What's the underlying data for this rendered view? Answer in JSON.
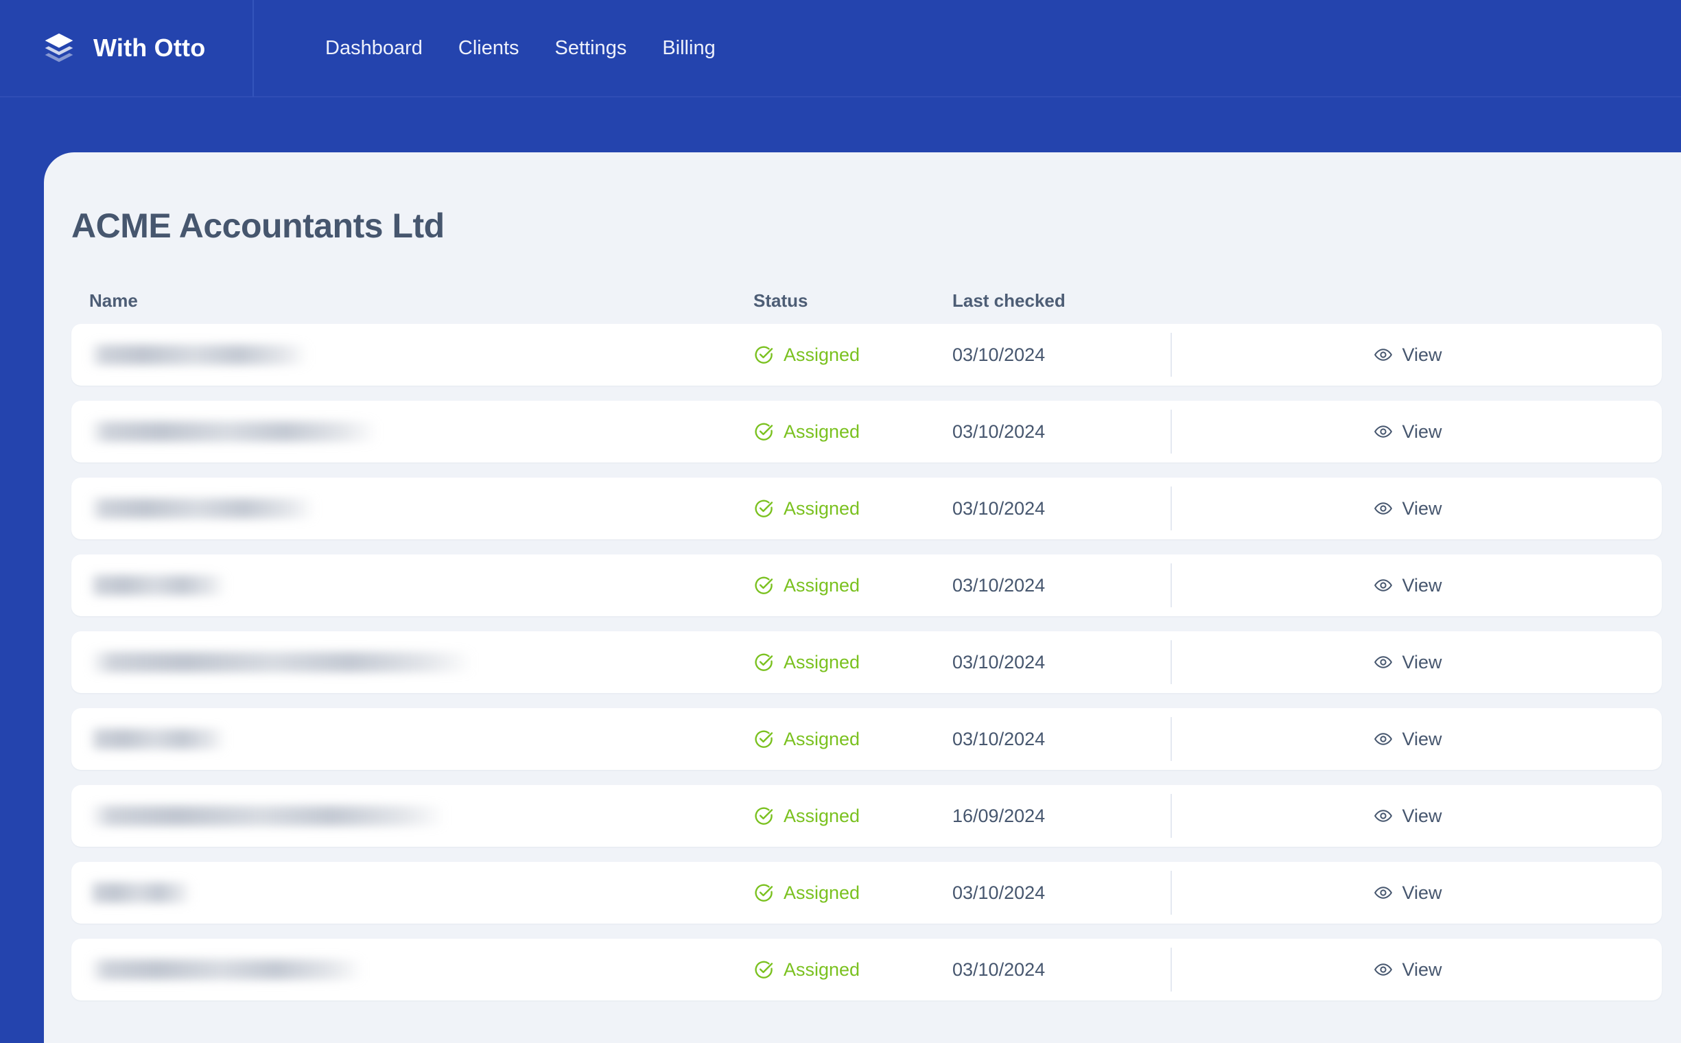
{
  "brand": {
    "name": "With Otto",
    "logo_icon": "layers-stack-icon",
    "bar_color": "#2444ae"
  },
  "nav": {
    "items": [
      {
        "label": "Dashboard"
      },
      {
        "label": "Clients"
      },
      {
        "label": "Settings"
      },
      {
        "label": "Billing"
      }
    ]
  },
  "page": {
    "title": "ACME Accountants Ltd"
  },
  "table": {
    "columns": {
      "name": "Name",
      "status": "Status",
      "last_checked": "Last checked"
    },
    "status_color": "#7ac11f",
    "status_icon": "check-circle-icon",
    "action_icon": "eye-icon",
    "action_label": "View",
    "rows": [
      {
        "name": "",
        "name_redacted": true,
        "name_width": 320,
        "status": "Assigned",
        "last_checked": "03/10/2024",
        "action": "View"
      },
      {
        "name": "",
        "name_redacted": true,
        "name_width": 420,
        "status": "Assigned",
        "last_checked": "03/10/2024",
        "action": "View"
      },
      {
        "name": "",
        "name_redacted": true,
        "name_width": 330,
        "status": "Assigned",
        "last_checked": "03/10/2024",
        "action": "View"
      },
      {
        "name": "",
        "name_redacted": true,
        "name_width": 200,
        "status": "Assigned",
        "last_checked": "03/10/2024",
        "action": "View"
      },
      {
        "name": "",
        "name_redacted": true,
        "name_width": 560,
        "status": "Assigned",
        "last_checked": "03/10/2024",
        "action": "View"
      },
      {
        "name": "",
        "name_redacted": true,
        "name_width": 200,
        "status": "Assigned",
        "last_checked": "03/10/2024",
        "action": "View"
      },
      {
        "name": "",
        "name_redacted": true,
        "name_width": 520,
        "status": "Assigned",
        "last_checked": "16/09/2024",
        "action": "View"
      },
      {
        "name": "",
        "name_redacted": true,
        "name_width": 150,
        "status": "Assigned",
        "last_checked": "03/10/2024",
        "action": "View"
      },
      {
        "name": "",
        "name_redacted": true,
        "name_width": 400,
        "status": "Assigned",
        "last_checked": "03/10/2024",
        "action": "View"
      }
    ]
  }
}
